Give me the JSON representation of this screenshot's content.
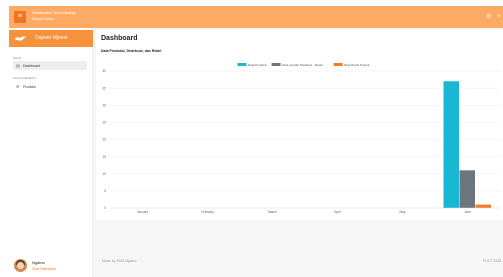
{
  "header": {
    "menu_icon": "menu-icon",
    "app_name": "Distribution Tool Monthly",
    "app_sub": "Report Harian",
    "icons": [
      "gear-icon",
      "close-icon"
    ]
  },
  "sidebar": {
    "brand_name": "Dapoer Mjoeni",
    "brand_icon": "bird-logo-icon",
    "sections": [
      {
        "label": "MAIN",
        "items": [
          {
            "label": "Dashboard",
            "icon": "dashboard-icon",
            "active": true
          }
        ]
      },
      {
        "label": "MANAGEMENT",
        "items": [
          {
            "label": "Produks",
            "icon": "gear-icon",
            "active": false
          }
        ]
      }
    ],
    "user": {
      "name": "Ngatno",
      "role": "Chef Distributor"
    }
  },
  "main": {
    "title": "Dashboard",
    "chart_heading": "Data Produksi, Distribusi, dan Retail"
  },
  "footer": {
    "left": "Made by 2025 Ngatno",
    "right": "PUCT 2025"
  },
  "colors": {
    "accent": "#f6913c",
    "topbar": "#fdab64",
    "series": [
      "#18b7d4",
      "#6c757d",
      "#f47c20"
    ]
  },
  "chart_data": {
    "type": "bar",
    "categories": [
      "January",
      "February",
      "March",
      "April",
      "May",
      "June"
    ],
    "series": [
      {
        "name": "Data Produksi",
        "values": [
          0,
          0,
          0,
          0,
          0,
          37
        ]
      },
      {
        "name": "Data Jumlah Distribusi - Retail",
        "values": [
          0,
          0,
          0,
          0,
          0,
          11
        ]
      },
      {
        "name": "Data Retail Produk",
        "values": [
          0,
          0,
          0,
          0,
          0,
          1
        ]
      }
    ],
    "ylim": [
      0,
      40
    ],
    "yticks": [
      0,
      5,
      10,
      15,
      20,
      25,
      30,
      35,
      40
    ],
    "grid": true,
    "legend": "top-center"
  }
}
